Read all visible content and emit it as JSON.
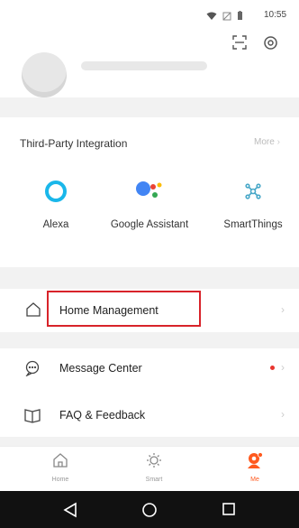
{
  "status_bar": {
    "time": "10:55"
  },
  "third_party": {
    "title": "Third-Party Integration",
    "more": "More",
    "services": [
      {
        "label": "Alexa",
        "icon": "alexa-icon"
      },
      {
        "label": "Google Assistant",
        "icon": "google-assistant-icon"
      },
      {
        "label": "SmartThings",
        "icon": "smartthings-icon"
      }
    ]
  },
  "menu": {
    "home_management": "Home Management",
    "message_center": "Message Center",
    "faq_feedback": "FAQ & Feedback"
  },
  "tabs": [
    {
      "label": "Home",
      "icon": "home-tab-icon"
    },
    {
      "label": "Smart",
      "icon": "smart-tab-icon"
    },
    {
      "label": "Me",
      "icon": "me-tab-icon"
    }
  ],
  "colors": {
    "highlight": "#d8232a",
    "accent": "#ff5a1f",
    "alexa": "#1ab7ea",
    "notification_dot": "#e8352f"
  }
}
